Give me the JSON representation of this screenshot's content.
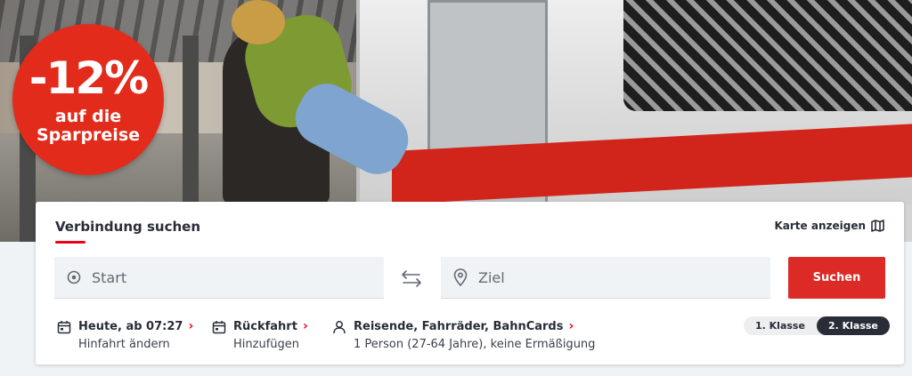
{
  "promo": {
    "percent": "-12%",
    "line1": "auf die",
    "line2": "Sparpreise"
  },
  "search": {
    "title": "Verbindung suchen",
    "map_link": "Karte anzeigen",
    "start_placeholder": "Start",
    "destination_placeholder": "Ziel",
    "submit_label": "Suchen"
  },
  "options": {
    "date": {
      "label": "Heute, ab 07:27",
      "sub": "Hinfahrt ändern"
    },
    "return": {
      "label": "Rückfahrt",
      "sub": "Hinzufügen"
    },
    "travellers": {
      "label": "Reisende, Fahrräder, BahnCards",
      "sub": "1 Person (27-64 Jahre), keine Ermäßigung"
    }
  },
  "travel_class": {
    "options": [
      "1. Klasse",
      "2. Klasse"
    ],
    "selected": "2. Klasse"
  },
  "colors": {
    "brand_red": "#ec0016",
    "button_red": "#dc2a27",
    "dark": "#282d37"
  }
}
